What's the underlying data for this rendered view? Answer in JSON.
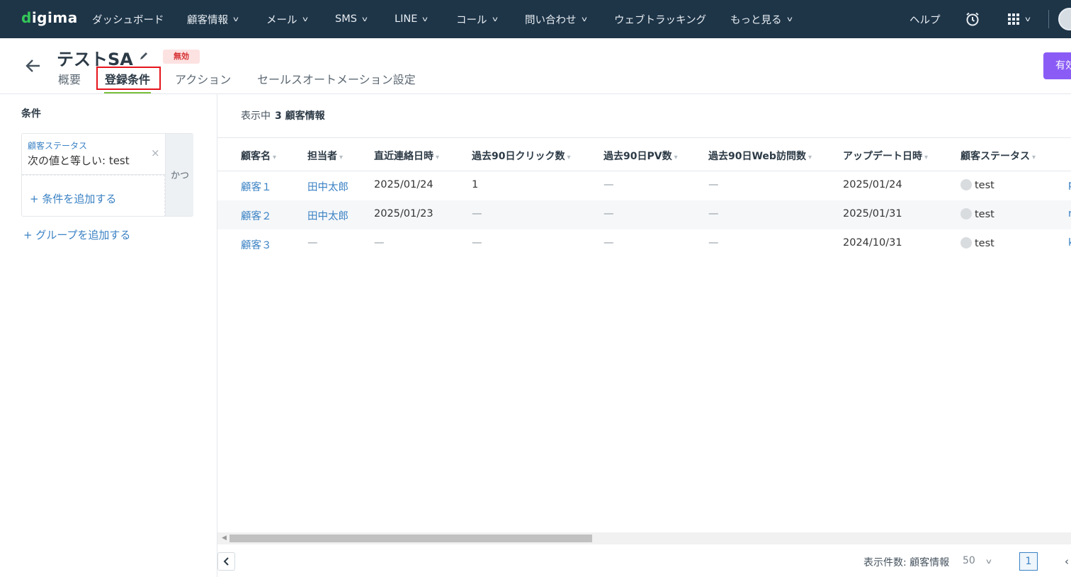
{
  "nav": {
    "logo": "digima",
    "items": [
      {
        "label": "ダッシュボード",
        "has_menu": false
      },
      {
        "label": "顧客情報",
        "has_menu": true
      },
      {
        "label": "メール",
        "has_menu": true
      },
      {
        "label": "SMS",
        "has_menu": true
      },
      {
        "label": "LINE",
        "has_menu": true
      },
      {
        "label": "コール",
        "has_menu": true
      },
      {
        "label": "問い合わせ",
        "has_menu": true
      },
      {
        "label": "ウェブトラッキング",
        "has_menu": false
      },
      {
        "label": "もっと見る",
        "has_menu": true
      }
    ],
    "help": "ヘルプ",
    "icons": [
      "alarm-clock-icon",
      "apps-grid-icon",
      "user-avatar-icon"
    ]
  },
  "header": {
    "title": "テストSA",
    "status_badge": "無効",
    "enable_button": "有効",
    "tabs": [
      "概要",
      "登録条件",
      "アクション",
      "セールスオートメーション設定"
    ],
    "active_tab": "登録条件"
  },
  "sidebar": {
    "title": "条件",
    "condition": {
      "field": "顧客ステータス",
      "value": "次の値と等しい: test"
    },
    "operator": "かつ",
    "add_condition": "+ 条件を追加する",
    "add_group": "+ グループを追加する"
  },
  "table": {
    "count_prefix": "表示中",
    "count_text": "3 顧客情報",
    "columns": [
      "顧客名",
      "担当者",
      "直近連絡日時",
      "過去90日クリック数",
      "過去90日PV数",
      "過去90日Web訪問数",
      "アップデート日時",
      "顧客ステータス"
    ],
    "rows": [
      {
        "name": "顧客１",
        "owner": "田中太郎",
        "last_contact": "2025/01/24",
        "clicks": "1",
        "pv": "—",
        "visits": "—",
        "updated": "2025/01/24",
        "status": "test",
        "extra": "p"
      },
      {
        "name": "顧客２",
        "owner": "田中太郎",
        "last_contact": "2025/01/23",
        "clicks": "—",
        "pv": "—",
        "visits": "—",
        "updated": "2025/01/31",
        "status": "test",
        "extra": "r"
      },
      {
        "name": "顧客３",
        "owner": "—",
        "last_contact": "—",
        "clicks": "—",
        "pv": "—",
        "visits": "—",
        "updated": "2024/10/31",
        "status": "test",
        "extra": "k"
      }
    ]
  },
  "pagination": {
    "label": "表示件数: 顧客情報",
    "page_size": "50",
    "current_page": "1"
  },
  "colors": {
    "nav_bg": "#1e3548",
    "link": "#3b82c4",
    "accent_purple": "#8a5cf5",
    "badge_bg": "#fde2e2",
    "badge_text": "#d63031",
    "highlight_red": "#e5141b",
    "tab_underline": "#7bbf3a"
  }
}
